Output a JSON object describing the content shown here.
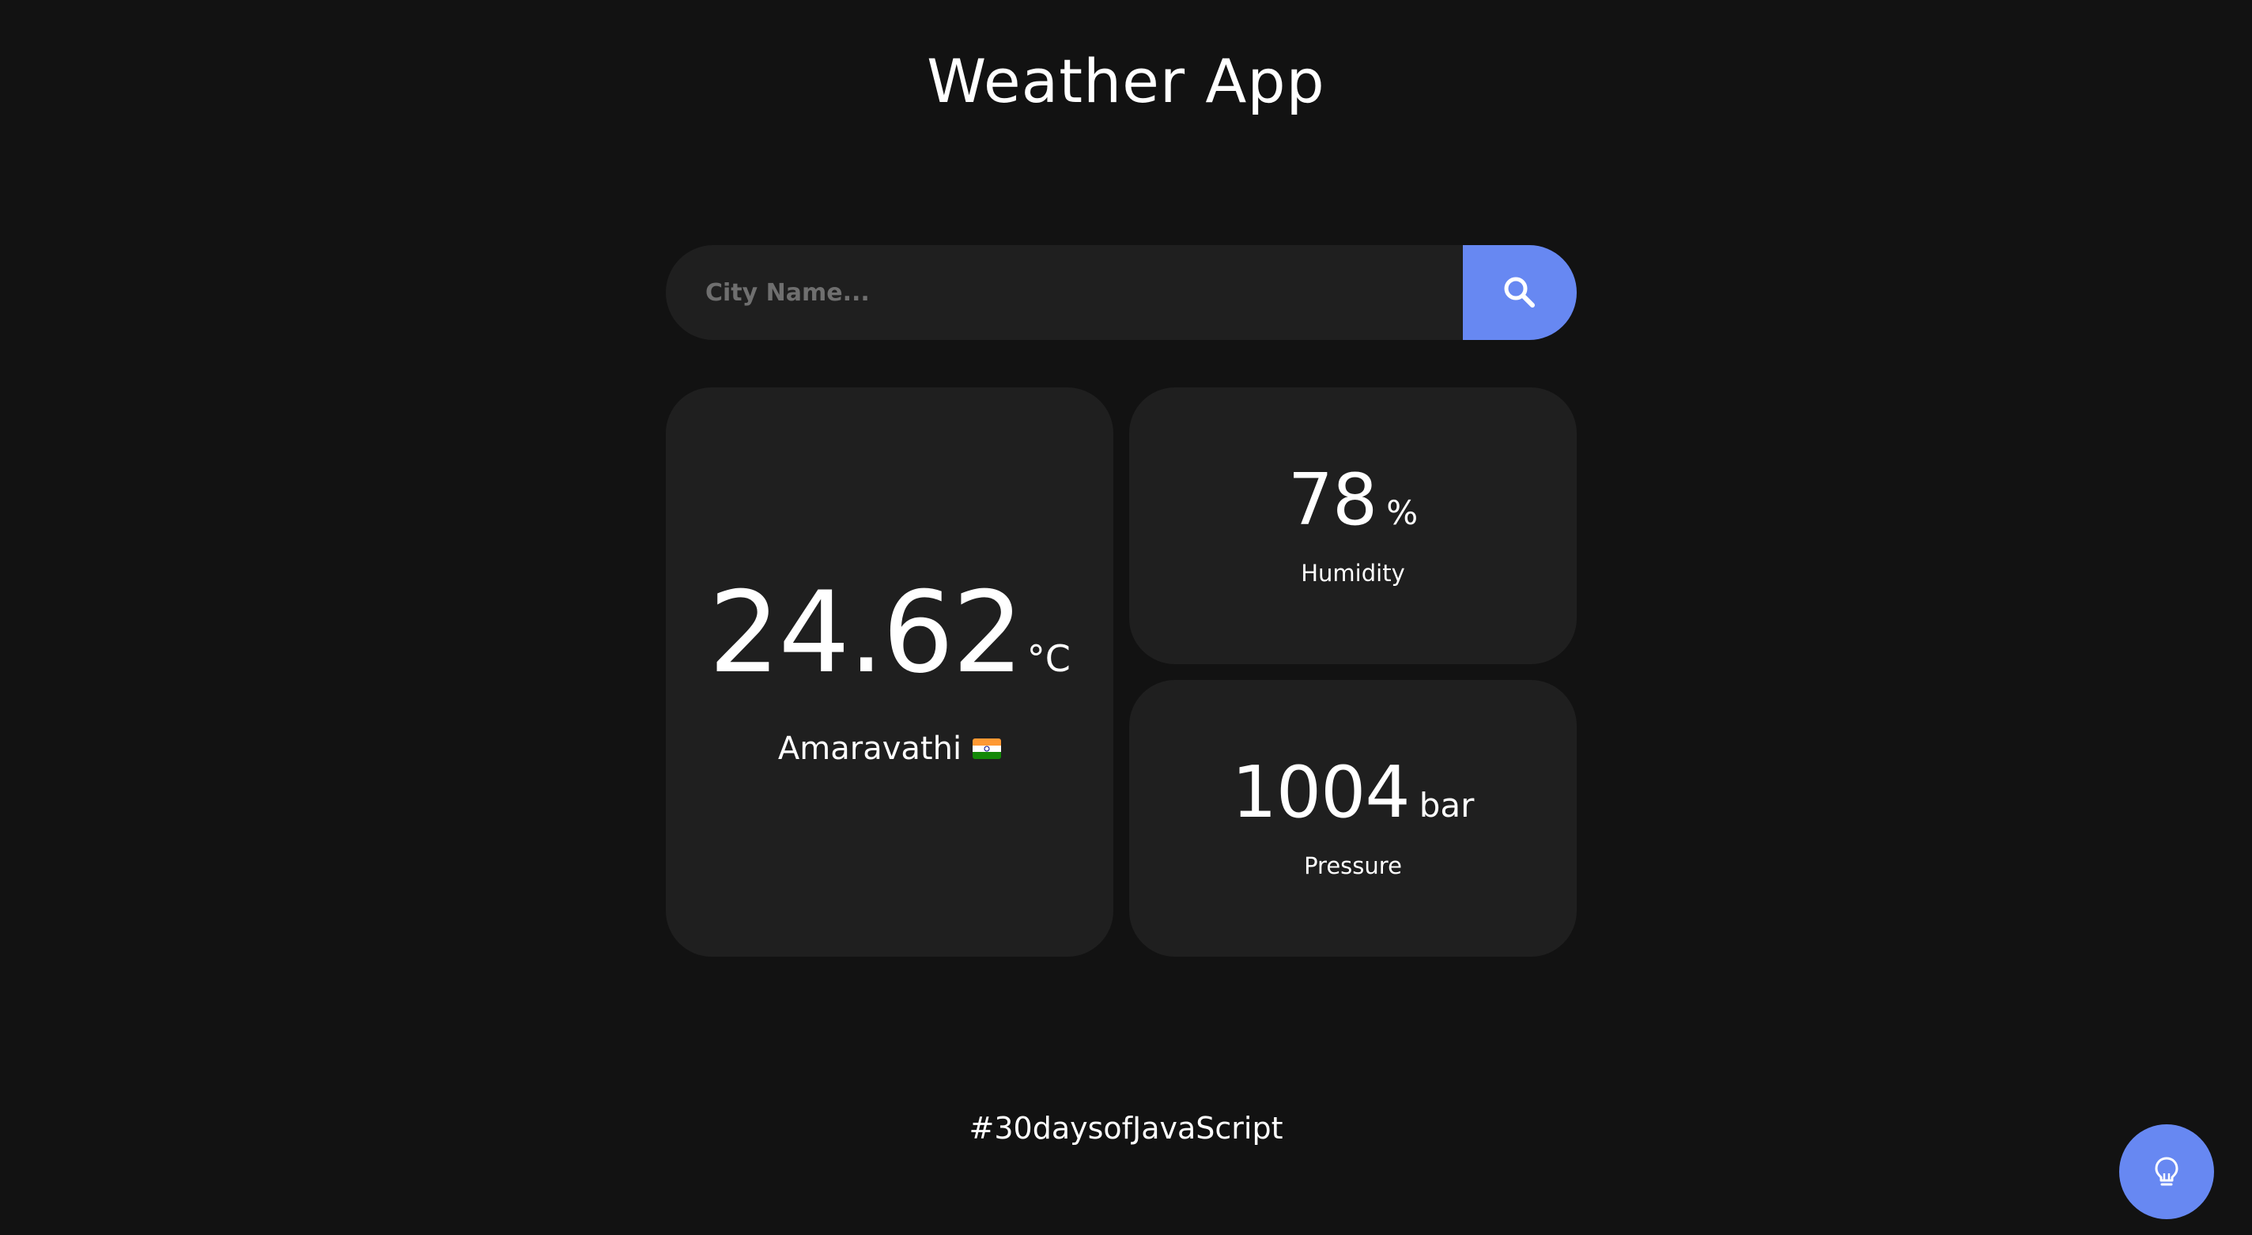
{
  "header": {
    "title": "Weather App"
  },
  "search": {
    "placeholder": "City Name...",
    "value": ""
  },
  "weather": {
    "temperature": "24.62",
    "temperature_unit": "°C",
    "city": "Amaravathi",
    "country_flag": "india-flag"
  },
  "humidity": {
    "value": "78",
    "unit": "%",
    "label": "Humidity"
  },
  "pressure": {
    "value": "1004",
    "unit": "bar",
    "label": "Pressure"
  },
  "footer": {
    "text": "#30daysofJavaScript"
  },
  "icons": {
    "search": "search-icon",
    "fab": "lightbulb-icon"
  },
  "colors": {
    "accent": "#6788f2",
    "background": "#121212",
    "card": "#1f1f1f"
  }
}
